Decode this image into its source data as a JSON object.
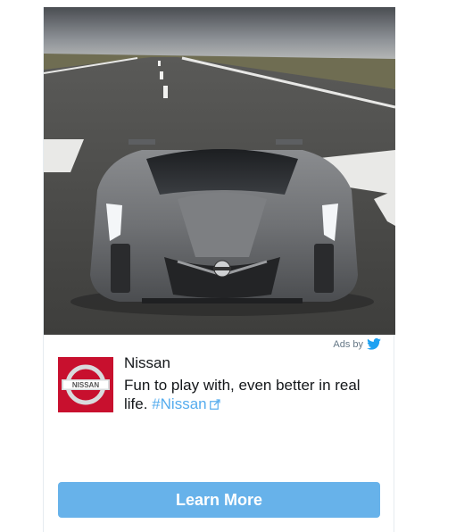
{
  "ad": {
    "ads_by_label": "Ads by",
    "advertiser_name": "Nissan",
    "body_text": "Fun to play with, even better in real life.",
    "hashtag": "#Nissan",
    "cta_label": "Learn More",
    "logo_text": "NISSAN",
    "colors": {
      "cta_background": "#67b2ea",
      "hashtag": "#55acee",
      "logo_background": "#c8102e",
      "twitter_bird": "#1da1f2"
    }
  },
  "icons": {
    "ads_by": "twitter-bird-icon",
    "link": "external-link-icon"
  }
}
